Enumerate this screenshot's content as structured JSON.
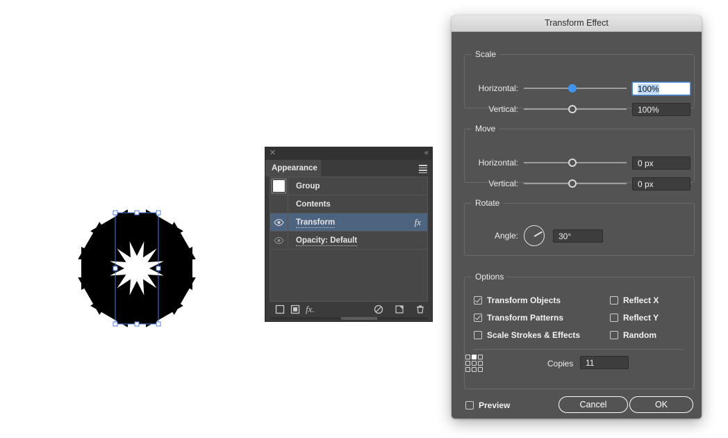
{
  "artwork": {
    "shape_count": 12,
    "shape_name": "triangle",
    "fill_color": "#000000",
    "selection_color": "#4a7fe0",
    "rotation_step_degrees": 30
  },
  "appearance_panel": {
    "close_icon": "✕",
    "collapse_icon": "«",
    "tab_label": "Appearance",
    "rows": [
      {
        "label": "Group",
        "kind": "swatch",
        "eye": "none",
        "fx": ""
      },
      {
        "label": "Contents",
        "kind": "plain",
        "eye": "none",
        "fx": ""
      },
      {
        "label": "Transform",
        "kind": "link",
        "eye": "on",
        "fx": "fx"
      },
      {
        "label": "Opacity: Default",
        "kind": "link-dim",
        "eye": "off",
        "fx": ""
      }
    ],
    "footer_icons": [
      "add-new-stroke-icon",
      "add-new-fill-icon",
      "add-new-effect-icon",
      "clear-appearance-icon",
      "duplicate-item-icon",
      "delete-item-icon"
    ]
  },
  "dialog": {
    "title": "Transform Effect",
    "scale": {
      "group_label": "Scale",
      "horizontal_label": "Horizontal:",
      "horizontal_value": "100%",
      "horizontal_slider_percent": 48,
      "vertical_label": "Vertical:",
      "vertical_value": "100%",
      "vertical_slider_percent": 48
    },
    "move": {
      "group_label": "Move",
      "horizontal_label": "Horizontal:",
      "horizontal_value": "0 px",
      "horizontal_slider_percent": 48,
      "vertical_label": "Vertical:",
      "vertical_value": "0 px",
      "vertical_slider_percent": 48
    },
    "rotate": {
      "group_label": "Rotate",
      "angle_label": "Angle:",
      "angle_value": "30°",
      "angle_degrees": 30
    },
    "options": {
      "group_label": "Options",
      "left_checkboxes": [
        {
          "label": "Transform Objects",
          "checked": true
        },
        {
          "label": "Transform Patterns",
          "checked": true
        },
        {
          "label": "Scale Strokes & Effects",
          "checked": false
        }
      ],
      "right_checkboxes": [
        {
          "label": "Reflect X",
          "checked": false
        },
        {
          "label": "Reflect Y",
          "checked": false
        },
        {
          "label": "Random",
          "checked": false
        }
      ],
      "reference_point_icon": "nine-point-grid-icon",
      "reference_point_selected": "top-center",
      "copies_label": "Copies",
      "copies_value": "11"
    },
    "footer": {
      "preview_label": "Preview",
      "preview_checked": false,
      "cancel_label": "Cancel",
      "ok_label": "OK"
    }
  }
}
